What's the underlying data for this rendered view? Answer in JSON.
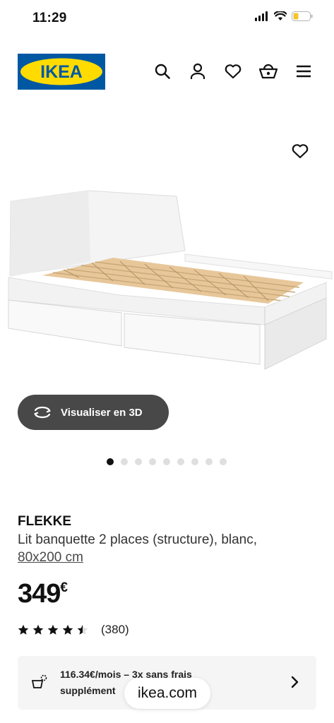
{
  "status": {
    "time": "11:29"
  },
  "header": {
    "logo_text": "IKEA",
    "icons": [
      "search-icon",
      "user-icon",
      "heart-icon",
      "basket-icon",
      "menu-icon"
    ]
  },
  "gallery": {
    "viz_button_label": "Visualiser en 3D",
    "dot_count": 9,
    "active_dot": 0
  },
  "product": {
    "name": "FLEKKE",
    "description": "Lit banquette 2 places (structure), blanc,",
    "size": "80x200 cm",
    "price": "349",
    "currency": "€",
    "rating": 4.5,
    "rating_count": "(380)"
  },
  "finance": {
    "line1": "116.34€/mois – 3x sans frais",
    "line2": "supplément"
  },
  "browser": {
    "url": "ikea.com"
  },
  "colors": {
    "ikea_blue": "#0058a3",
    "ikea_yellow": "#ffdb00",
    "button_dark": "#484848"
  }
}
